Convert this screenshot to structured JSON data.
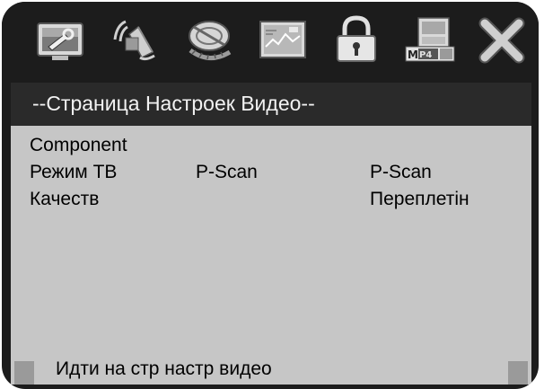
{
  "menu_icons": [
    {
      "name": "general-setup-icon"
    },
    {
      "name": "audio-setup-icon"
    },
    {
      "name": "dolby-setup-icon"
    },
    {
      "name": "video-setup-icon"
    },
    {
      "name": "preference-lock-icon"
    },
    {
      "name": "mp4-setup-icon"
    },
    {
      "name": "exit-icon"
    }
  ],
  "page": {
    "title": "--Страница Настроек Видео--"
  },
  "options": {
    "component_label": "Component",
    "tv_mode_label": "Режим ТВ",
    "tv_mode_value": "P-Scan",
    "tv_mode_submenu_value": "P-Scan",
    "quality_label": "Качеств",
    "quality_submenu_value": "Переплетін"
  },
  "status": {
    "hint": "Идти на стр настр видео"
  },
  "colors": {
    "frame": "#1c1c1c",
    "title_bar": "#2a2a2a",
    "content_bg": "#c6c6c6",
    "title_text": "#f2f2f2"
  }
}
